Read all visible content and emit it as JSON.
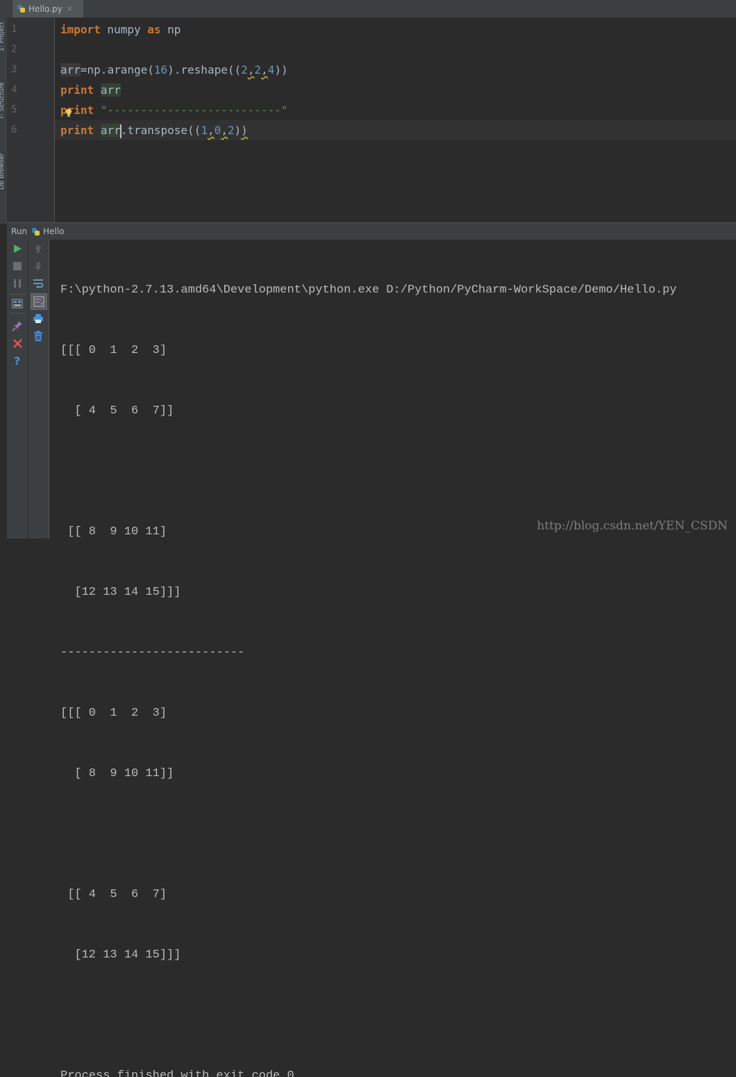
{
  "side_tabs": [
    "1: Project",
    "7: Structure",
    "DB Browser"
  ],
  "tab": {
    "label": "Hello.py",
    "close": "×"
  },
  "gutter": {
    "line_numbers": [
      "1",
      "2",
      "3",
      "4",
      "5",
      "6"
    ]
  },
  "code": {
    "l1": {
      "kw_import": "import",
      "module": " numpy ",
      "kw_as": "as",
      "alias": " np"
    },
    "l3": {
      "var": "arr",
      "rest1": "=np.arange(",
      "n16": "16",
      "rest2": ").reshape((",
      "n2a": "2",
      "c1": ",",
      "n2b": "2",
      "c2": ",",
      "n4": "4",
      "rest3": "))"
    },
    "l4": {
      "kw": "print",
      "sp": " ",
      "var": "arr"
    },
    "l5": {
      "kw": "print",
      "sp": " ",
      "str": "\"--------------------------\""
    },
    "l6": {
      "kw": "print",
      "sp": " ",
      "var": "arr",
      "rest1": ".transpose((",
      "n1": "1",
      "c1": ",",
      "n0": "0",
      "c2": ",",
      "n2": "2",
      "rest2": ")",
      "rest3": ")"
    }
  },
  "run_panel": {
    "label": "Run",
    "config": "Hello"
  },
  "console": {
    "lines": [
      "F:\\python-2.7.13.amd64\\Development\\python.exe D:/Python/PyCharm-WorkSpace/Demo/Hello.py",
      "[[[ 0  1  2  3]",
      "  [ 4  5  6  7]]",
      "",
      " [[ 8  9 10 11]",
      "  [12 13 14 15]]]",
      "--------------------------",
      "[[[ 0  1  2  3]",
      "  [ 8  9 10 11]]",
      "",
      " [[ 4  5  6  7]",
      "  [12 13 14 15]]]",
      "",
      "Process finished with exit code 0"
    ]
  },
  "watermark": "http://blog.csdn.net/YEN_CSDN",
  "colors": {
    "keyword": "#cc7832",
    "number": "#6897bb",
    "string": "#6a8759",
    "text": "#a9b7c6",
    "background": "#2b2b2b"
  },
  "icons": [
    "python-file-icon",
    "run-icon",
    "stop-icon",
    "pause-icon",
    "up-arrow-icon",
    "down-arrow-icon",
    "soft-wrap-icon",
    "scroll-to-end-icon",
    "print-icon",
    "trash-icon",
    "restore-layout-icon",
    "pin-icon",
    "close-icon",
    "help-icon",
    "lightbulb-icon"
  ]
}
